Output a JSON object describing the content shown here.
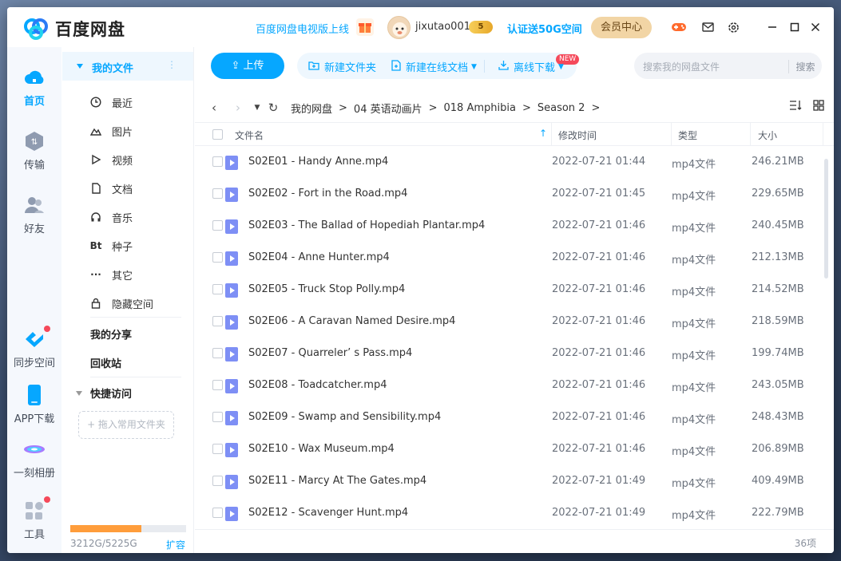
{
  "app": {
    "logo_text": "百度网盘",
    "tv_promo": "百度网盘电视版上线",
    "username": "jixutao001",
    "vip_badge": "5",
    "cert_promo": "认证送50G空间",
    "member_center": "会员中心",
    "colors": {
      "accent": "#06a7ff",
      "quota": "#ff9d3b",
      "vip": "#f2d5a5",
      "file_icon": "#7e8ff5"
    }
  },
  "rail": {
    "items": [
      {
        "label": "首页",
        "icon": "cloud-icon"
      },
      {
        "label": "传输",
        "icon": "transfer-icon"
      },
      {
        "label": "好友",
        "icon": "friends-icon"
      },
      {
        "label": "同步空间",
        "icon": "sync-icon"
      },
      {
        "label": "APP下载",
        "icon": "phone-icon"
      },
      {
        "label": "一刻相册",
        "icon": "album-icon"
      },
      {
        "label": "工具",
        "icon": "tools-icon"
      }
    ]
  },
  "sidebar": {
    "my_files": "我的文件",
    "items": [
      {
        "label": "最近",
        "icon": "clock-icon"
      },
      {
        "label": "图片",
        "icon": "image-icon"
      },
      {
        "label": "视频",
        "icon": "play-icon"
      },
      {
        "label": "文档",
        "icon": "document-icon"
      },
      {
        "label": "音乐",
        "icon": "headphones-icon"
      },
      {
        "label": "种子",
        "icon": "bt-icon"
      },
      {
        "label": "其它",
        "icon": "more-icon"
      },
      {
        "label": "隐藏空间",
        "icon": "lock-icon"
      }
    ],
    "my_share": "我的分享",
    "recycle": "回收站",
    "quick_access": "快捷访问",
    "drop_hint": "+ 拖入常用文件夹",
    "quota_text": "3212G/5225G",
    "quota_ratio": 0.615,
    "expand": "扩容"
  },
  "toolbar": {
    "upload": "上传",
    "new_folder": "新建文件夹",
    "new_doc": "新建在线文档",
    "new_badge": "NEW",
    "offline": "离线下载",
    "search_placeholder": "搜索我的网盘文件",
    "search_button": "搜索"
  },
  "breadcrumb": [
    "我的网盘",
    "04 英语动画片",
    "018 Amphibia",
    "Season 2"
  ],
  "table": {
    "headers": {
      "name": "文件名",
      "time": "修改时间",
      "type": "类型",
      "size": "大小"
    },
    "rows": [
      {
        "name": "S02E01 - Handy Anne.mp4",
        "time": "2022-07-21 01:44",
        "type": "mp4文件",
        "size": "246.21MB"
      },
      {
        "name": "S02E02 - Fort in the Road.mp4",
        "time": "2022-07-21 01:45",
        "type": "mp4文件",
        "size": "229.65MB"
      },
      {
        "name": "S02E03 - The Ballad of Hopediah Plantar.mp4",
        "time": "2022-07-21 01:46",
        "type": "mp4文件",
        "size": "240.45MB"
      },
      {
        "name": "S02E04 - Anne Hunter.mp4",
        "time": "2022-07-21 01:46",
        "type": "mp4文件",
        "size": "212.13MB"
      },
      {
        "name": "S02E05 - Truck Stop Polly.mp4",
        "time": "2022-07-21 01:46",
        "type": "mp4文件",
        "size": "214.52MB"
      },
      {
        "name": "S02E06 - A Caravan Named Desire.mp4",
        "time": "2022-07-21 01:46",
        "type": "mp4文件",
        "size": "218.59MB"
      },
      {
        "name": "S02E07 - Quarreler’ s Pass.mp4",
        "time": "2022-07-21 01:46",
        "type": "mp4文件",
        "size": "199.74MB"
      },
      {
        "name": "S02E08 - Toadcatcher.mp4",
        "time": "2022-07-21 01:46",
        "type": "mp4文件",
        "size": "243.05MB"
      },
      {
        "name": "S02E09 - Swamp and Sensibility.mp4",
        "time": "2022-07-21 01:46",
        "type": "mp4文件",
        "size": "248.43MB"
      },
      {
        "name": "S02E10 - Wax Museum.mp4",
        "time": "2022-07-21 01:46",
        "type": "mp4文件",
        "size": "206.89MB"
      },
      {
        "name": "S02E11 - Marcy At The Gates.mp4",
        "time": "2022-07-21 01:49",
        "type": "mp4文件",
        "size": "409.49MB"
      },
      {
        "name": "S02E12 - Scavenger Hunt.mp4",
        "time": "2022-07-21 01:49",
        "type": "mp4文件",
        "size": "222.79MB"
      }
    ]
  },
  "footer": {
    "count": "36项"
  }
}
